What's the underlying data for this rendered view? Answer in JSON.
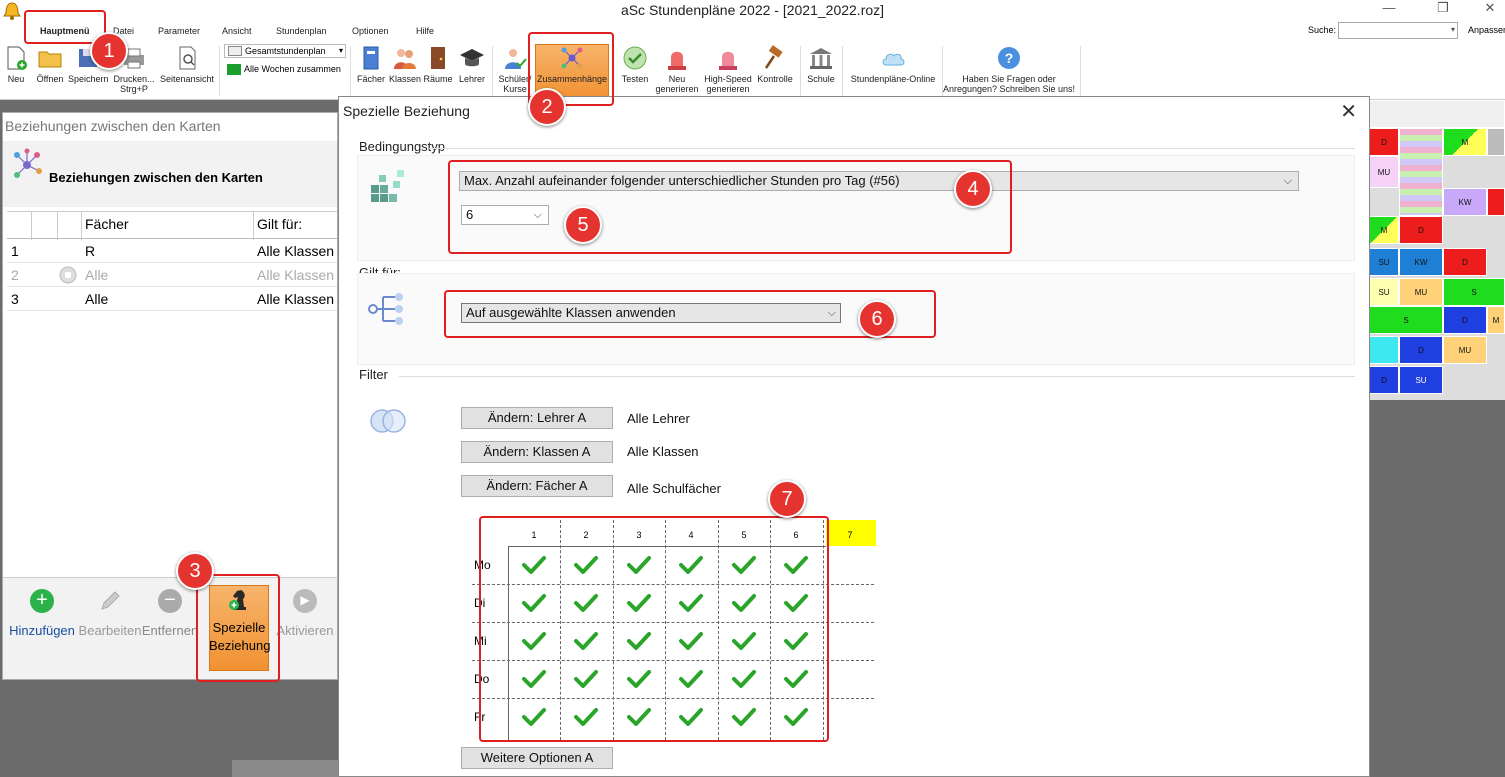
{
  "window": {
    "title": "aSc Stundenpläne 2022  - [2021_2022.roz]"
  },
  "ribbon_tabs": [
    "Hauptmenü",
    "Datei",
    "Parameter",
    "Ansicht",
    "Stundenplan",
    "Optionen",
    "Hilfe"
  ],
  "search": {
    "label": "Suche:",
    "customize": "Anpassen"
  },
  "ribbon": {
    "new": "Neu",
    "open": "Öffnen",
    "save": "Speichern",
    "print": "Drucken...",
    "print_shortcut": "Strg+P",
    "page_view": "Seitenansicht",
    "combo_timetable": "Gesamtstundenplan",
    "combo_weeks": "Alle Wochen zusammen",
    "subjects": "Fächer",
    "classes": "Klassen",
    "rooms": "Räume",
    "teachers": "Lehrer",
    "students": "Schüler/",
    "students_2": "Kurse",
    "relations": "Zusammenhänge",
    "test": "Testen",
    "regen": "Neu",
    "regen_2": "generieren",
    "hs_gen": "High-Speed",
    "hs_gen_2": "generieren",
    "check": "Kontrolle",
    "school": "Schule",
    "online": "Stundenpläne-Online",
    "feedback": "Haben Sie Fragen oder",
    "feedback_2": "Anregungen? Schreiben Sie uns!"
  },
  "left_dialog": {
    "title": "Beziehungen zwischen den Karten",
    "heading": "Beziehungen zwischen den Karten",
    "columns": {
      "subjects": "Fächer",
      "applies": "Gilt für:"
    },
    "rows": [
      {
        "num": "1",
        "subject": "R",
        "applies": "Alle Klassen"
      },
      {
        "num": "2",
        "subject": "Alle",
        "applies": "Alle Klassen"
      },
      {
        "num": "3",
        "subject": "Alle",
        "applies": "Alle Klassen"
      }
    ],
    "toolbar": {
      "add": "Hinzufügen",
      "edit": "Bearbeiten",
      "remove": "Entfernen",
      "special": "Spezielle",
      "special_2": "Beziehung",
      "activate": "Aktivieren"
    }
  },
  "main_dialog": {
    "title": "Spezielle Beziehung",
    "condition_type_label": "Bedingungstyp",
    "condition_type_value": "Max. Anzahl aufeinander folgender unterschiedlicher Stunden pro Tag (#56)",
    "count_value": "6",
    "applies_label": "Gilt für:",
    "applies_value": "Auf ausgewählte Klassen anwenden",
    "filter_label": "Filter",
    "filters": [
      {
        "button": "Ändern: Lehrer A",
        "value": "Alle Lehrer"
      },
      {
        "button": "Ändern: Klassen A",
        "value": "Alle Klassen"
      },
      {
        "button": "Ändern: Fächer A",
        "value": "Alle Schulfächer"
      }
    ],
    "grid": {
      "columns": [
        "1",
        "2",
        "3",
        "4",
        "5",
        "6",
        "7"
      ],
      "days": [
        "Mo",
        "Di",
        "Mi",
        "Do",
        "Fr"
      ]
    },
    "more_options": "Weitere Optionen A"
  },
  "badges": [
    "1",
    "2",
    "3",
    "4",
    "5",
    "6",
    "7"
  ],
  "bg_timetable": {
    "cells": [
      "D",
      "M",
      "MU",
      "KW",
      "M",
      "D",
      "SU",
      "KW",
      "D",
      "SU",
      "MU",
      "S",
      "S",
      "D",
      "M",
      "D",
      "MU",
      "D",
      "SU"
    ]
  },
  "colors": {
    "accent_orange": "#f19233",
    "annotation_red": "#e02020",
    "check_green": "#2aa52a",
    "grid_highlight": "#ffff00"
  }
}
